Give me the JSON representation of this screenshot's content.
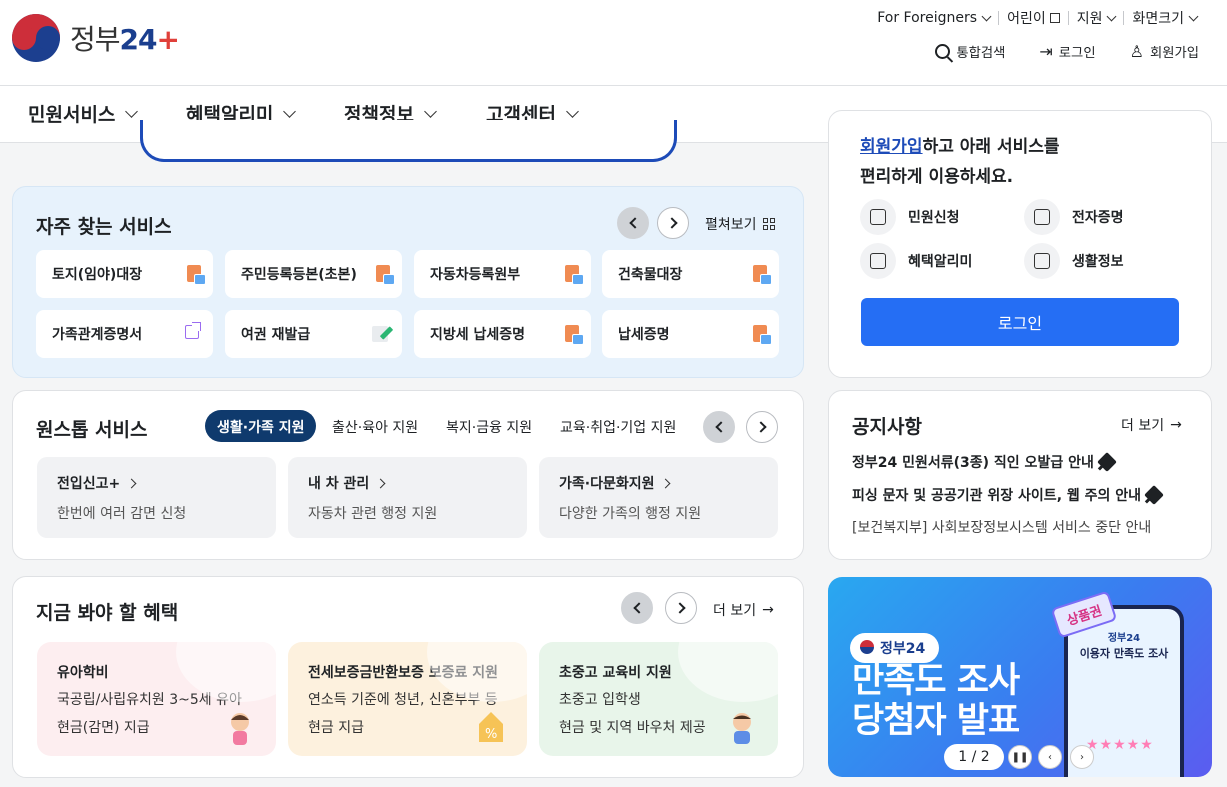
{
  "header": {
    "logo_text": "정부",
    "logo_num": "24",
    "logo_plus": "+",
    "utility": [
      {
        "label": "For Foreigners"
      },
      {
        "label": "어린이"
      },
      {
        "label": "지원"
      },
      {
        "label": "화면크기"
      }
    ],
    "search_label": "통합검색",
    "login_label": "로그인",
    "signup_label": "회원가입"
  },
  "nav": {
    "items": [
      {
        "label": "민원서비스"
      },
      {
        "label": "혜택알리미"
      },
      {
        "label": "정책정보"
      },
      {
        "label": "고객센터"
      }
    ]
  },
  "frequent": {
    "title": "자주 찾는 서비스",
    "expand_label": "펼쳐보기",
    "services": [
      {
        "label": "토지(임야)대장",
        "icon": "document-icon"
      },
      {
        "label": "주민등록등본(초본)",
        "icon": "document-icon"
      },
      {
        "label": "자동차등록원부",
        "icon": "document-icon"
      },
      {
        "label": "건축물대장",
        "icon": "document-icon"
      },
      {
        "label": "가족관계증명서",
        "icon": "external-link-icon"
      },
      {
        "label": "여권 재발급",
        "icon": "edit-icon"
      },
      {
        "label": "지방세 납세증명",
        "icon": "document-icon"
      },
      {
        "label": "납세증명",
        "icon": "document-icon"
      }
    ]
  },
  "onestop": {
    "title": "원스톱 서비스",
    "tabs": [
      {
        "label": "생활·가족 지원",
        "active": true
      },
      {
        "label": "출산·육아 지원",
        "active": false
      },
      {
        "label": "복지·금융 지원",
        "active": false
      },
      {
        "label": "교육·취업·기업 지원",
        "active": false
      }
    ],
    "boxes": [
      {
        "title": "전입신고+",
        "desc": "한번에 여러 감면 신청"
      },
      {
        "title": "내 차 관리",
        "desc": "자동차 관련 행정 지원"
      },
      {
        "title": "가족·다문화지원",
        "desc": "다양한 가족의 행정 지원"
      }
    ]
  },
  "benefit": {
    "title": "지금 봐야 할 혜택",
    "more_label": "더 보기",
    "cards": [
      {
        "title": "유아학비",
        "line1": "국공립/사립유치원 3~5세 유아",
        "line2": "현금(감면) 지급",
        "bg": "#fdeef0"
      },
      {
        "title": "전세보증금반환보증 보증료 지원",
        "line1": "연소득 기준에 청년, 신혼부부 등",
        "line2": "현금 지급",
        "bg": "#fdf1de"
      },
      {
        "title": "초중고 교육비 지원",
        "line1": "초중고 입학생",
        "line2": "현금 및 지역 바우처 제공",
        "bg": "#e8f5ea"
      }
    ]
  },
  "login_box": {
    "line1_link": "회원가입",
    "line1_rest": "하고 아래 서비스를",
    "line2": "편리하게 이용하세요.",
    "quick": [
      {
        "label": "민원신청"
      },
      {
        "label": "전자증명"
      },
      {
        "label": "혜택알리미"
      },
      {
        "label": "생활정보"
      }
    ],
    "button": "로그인"
  },
  "notice": {
    "title": "공지사항",
    "more_label": "더 보기",
    "items": [
      {
        "text": "정부24 민원서류(3종) 직인 오발급 안내",
        "pinned": true
      },
      {
        "text": "피싱 문자 및 공공기관 위장 사이트, 웹 주의 안내",
        "pinned": true
      },
      {
        "text": "[보건복지부] 사회보장정보시스템 서비스 중단 안내",
        "pinned": false
      }
    ]
  },
  "banner": {
    "badge": "정부24",
    "headline1": "만족도 조사",
    "headline2": "당첨자 발표",
    "phone_brand": "정부24",
    "phone_title": "이용자 만족도 조사",
    "ribbon": "상품권",
    "pager": "1 / 2",
    "stars": "★★★★★"
  },
  "colors": {
    "primary": "#256ef4",
    "active_tab": "#0f3a6d",
    "search_border": "#1d4bb8"
  }
}
